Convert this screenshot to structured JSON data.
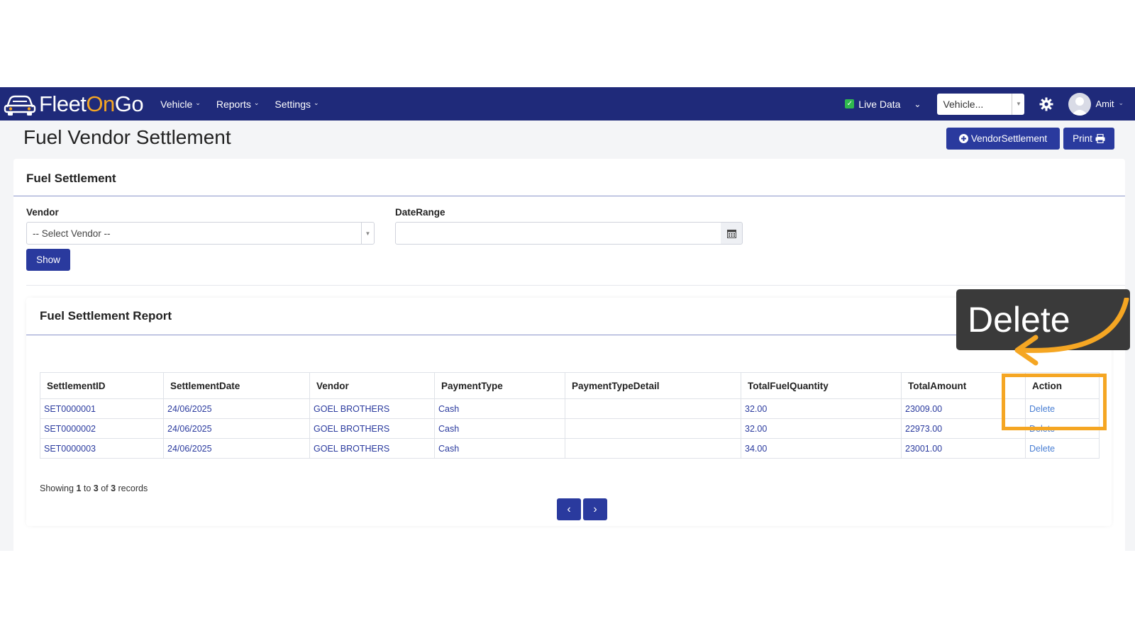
{
  "navbar": {
    "logo": {
      "fleet": "Fleet",
      "on": "On",
      "go": "Go"
    },
    "menu": [
      {
        "label": "Vehicle"
      },
      {
        "label": "Reports"
      },
      {
        "label": "Settings"
      }
    ],
    "live_data_label": "Live Data",
    "vehicle_select_value": "Vehicle...",
    "user_name": "Amit"
  },
  "header": {
    "title": "Fuel Vendor Settlement",
    "vendor_settlement_button": "VendorSettlement",
    "print_button": "Print"
  },
  "filter": {
    "card_title": "Fuel Settlement",
    "vendor_label": "Vendor",
    "vendor_value": "-- Select Vendor --",
    "daterange_label": "DateRange",
    "daterange_value": "",
    "show_button": "Show"
  },
  "report": {
    "title": "Fuel Settlement Report",
    "columns": [
      "SettlementID",
      "SettlementDate",
      "Vendor",
      "PaymentType",
      "PaymentTypeDetail",
      "TotalFuelQuantity",
      "TotalAmount",
      "Action"
    ],
    "rows": [
      [
        "SET0000001",
        "24/06/2025",
        "GOEL BROTHERS",
        "Cash",
        "",
        "32.00",
        "23009.00",
        "Delete"
      ],
      [
        "SET0000002",
        "24/06/2025",
        "GOEL BROTHERS",
        "Cash",
        "",
        "32.00",
        "22973.00",
        "Delete"
      ],
      [
        "SET0000003",
        "24/06/2025",
        "GOEL BROTHERS",
        "Cash",
        "",
        "34.00",
        "23001.00",
        "Delete"
      ]
    ],
    "showing": {
      "prefix": "Showing ",
      "from": "1",
      "to_word": " to ",
      "to": "3",
      "of_word": " of ",
      "total": "3",
      "suffix": " records"
    },
    "prev_icon": "‹",
    "next_icon": "›"
  },
  "annotation": {
    "tooltip_text": "Delete",
    "highlight_color": "#f5a623"
  },
  "colors": {
    "navbar": "#1f2a7a",
    "primary_button": "#2a3a9e",
    "link": "#2a3a9e",
    "live_check": "#2fb84e"
  }
}
